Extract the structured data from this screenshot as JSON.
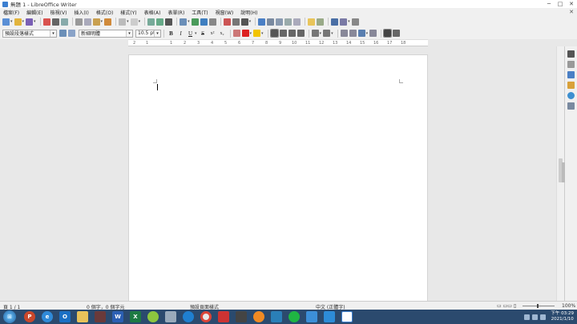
{
  "window": {
    "title": "無題 1 - LibreOffice Writer",
    "min": "─",
    "max": "□",
    "close": "✕"
  },
  "menu": [
    "檔案(F)",
    "編輯(E)",
    "檢視(V)",
    "插入(I)",
    "格式(O)",
    "樣式(Y)",
    "表格(A)",
    "表單(R)",
    "工具(T)",
    "視窗(W)",
    "說明(H)"
  ],
  "menu_close": "✕",
  "formatting": {
    "paragraph_style": "預設段落樣式",
    "font_name": "新細明體",
    "font_size": "10.5 pt",
    "bold": "B",
    "italic": "I",
    "underline": "U",
    "strike": "S",
    "superscript": "x²",
    "subscript": "x₂"
  },
  "ruler": {
    "marks": [
      "1",
      "2",
      "1",
      "2",
      "3",
      "4",
      "5",
      "6",
      "7",
      "8",
      "9",
      "10",
      "11",
      "12",
      "13",
      "14",
      "15",
      "16",
      "17",
      "18"
    ]
  },
  "status": {
    "page": "頁 1 / 1",
    "words": "0 個字，0 個字元",
    "page_style": "預設頁面樣式",
    "language": "中文 (正體字)",
    "zoom": "100%"
  },
  "clock": {
    "time": "下午 03:29",
    "date": "2021/1/10"
  },
  "colors": {
    "accent": "#3c7fd0",
    "taskbar": "#2b4a6e"
  }
}
